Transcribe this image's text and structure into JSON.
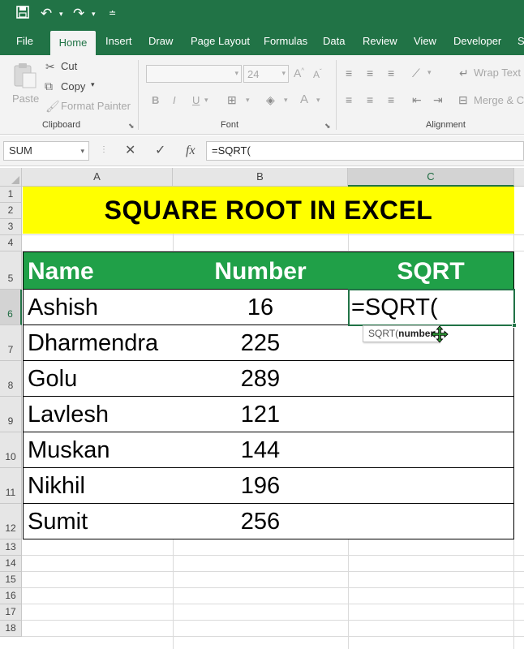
{
  "quick_access": {
    "save_icon": "save-icon",
    "undo_icon": "undo-icon",
    "redo_icon": "redo-icon"
  },
  "tabs": [
    "File",
    "Home",
    "Insert",
    "Draw",
    "Page Layout",
    "Formulas",
    "Data",
    "Review",
    "View",
    "Developer",
    "S"
  ],
  "active_tab": "Home",
  "ribbon": {
    "clipboard": {
      "paste": "Paste",
      "cut": "Cut",
      "copy": "Copy",
      "format_painter": "Format Painter",
      "label": "Clipboard"
    },
    "font": {
      "size": "24",
      "bold": "B",
      "italic": "I",
      "underline": "U",
      "label": "Font"
    },
    "alignment": {
      "wrap_text": "Wrap Text",
      "merge_center": "Merge & C",
      "label": "Alignment"
    }
  },
  "formula_bar": {
    "name_box": "SUM",
    "cancel": "✕",
    "enter": "✓",
    "fx": "fx",
    "formula": "=SQRT("
  },
  "columns": [
    "A",
    "B",
    "C"
  ],
  "rows": [
    "1",
    "2",
    "3",
    "4",
    "5",
    "6",
    "7",
    "8",
    "9",
    "10",
    "11",
    "12",
    "13",
    "14",
    "15",
    "16",
    "17",
    "18"
  ],
  "sheet": {
    "title": "SQUARE ROOT IN EXCEL",
    "headers": [
      "Name",
      "Number",
      "SQRT"
    ],
    "data": [
      {
        "name": "Ashish",
        "number": "16"
      },
      {
        "name": "Dharmendra",
        "number": "225"
      },
      {
        "name": "Golu",
        "number": "289"
      },
      {
        "name": "Lavlesh",
        "number": "121"
      },
      {
        "name": "Muskan",
        "number": "144"
      },
      {
        "name": "Nikhil",
        "number": "196"
      },
      {
        "name": "Sumit",
        "number": "256"
      }
    ],
    "active_cell": "=SQRT(",
    "tooltip_fn": "SQRT(",
    "tooltip_arg": "number"
  },
  "colors": {
    "excel_green": "#217346",
    "header_green": "#20a048",
    "title_yellow": "#ffff00"
  }
}
